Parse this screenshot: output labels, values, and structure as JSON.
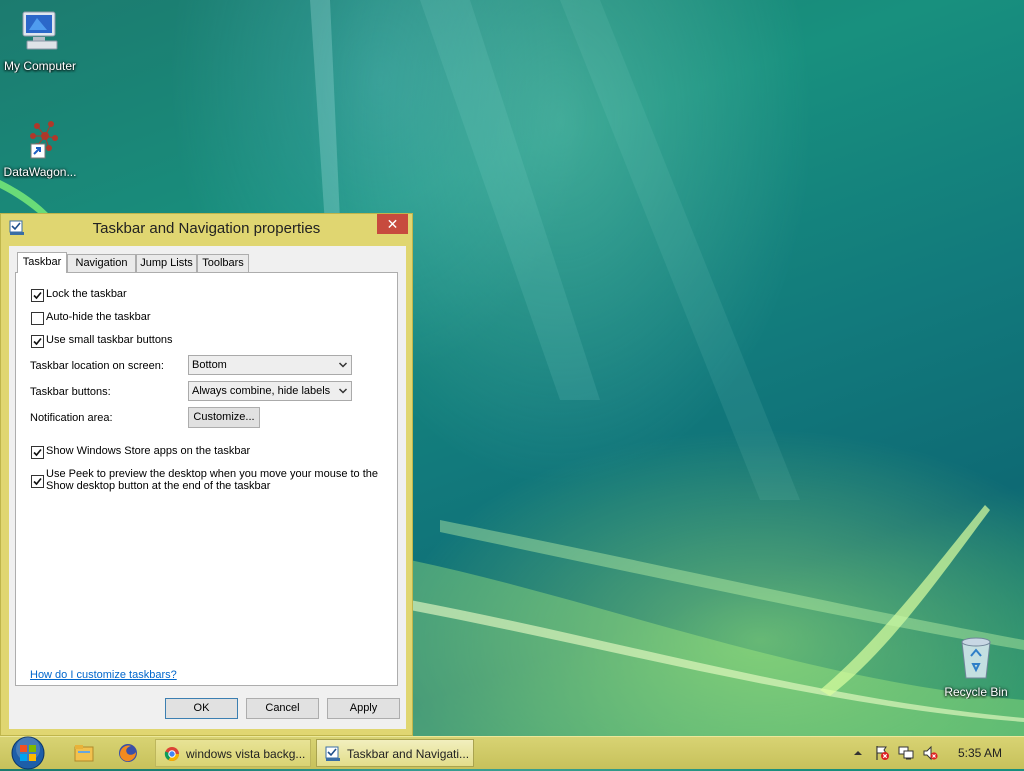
{
  "desktop": {
    "icons": [
      {
        "label": "My Computer"
      },
      {
        "label": "DataWagon..."
      },
      {
        "label": "Recycle Bin"
      }
    ]
  },
  "dialog": {
    "title": "Taskbar and Navigation properties",
    "close_glyph": "✕",
    "tabs": [
      {
        "label": "Taskbar"
      },
      {
        "label": "Navigation"
      },
      {
        "label": "Jump Lists"
      },
      {
        "label": "Toolbars"
      }
    ],
    "taskbar_tab": {
      "options": [
        {
          "label": "Lock the taskbar",
          "checked": true
        },
        {
          "label": "Auto-hide the taskbar",
          "checked": false
        },
        {
          "label": "Use small taskbar buttons",
          "checked": true
        }
      ],
      "location_label": "Taskbar location on screen:",
      "location_value": "Bottom",
      "buttons_label": "Taskbar buttons:",
      "buttons_value": "Always combine, hide labels",
      "notification_label": "Notification area:",
      "customize_label": "Customize...",
      "store_apps": {
        "label": "Show Windows Store apps on the taskbar",
        "checked": true
      },
      "peek": {
        "line1": "Use Peek to preview the desktop when you move your mouse to the",
        "line2": "Show desktop button at the end of the taskbar",
        "checked": true
      },
      "help_link": "How do I customize taskbars?"
    },
    "buttons": {
      "ok": "OK",
      "cancel": "Cancel",
      "apply": "Apply"
    }
  },
  "taskbar": {
    "windows": [
      {
        "label": "windows vista backg..."
      },
      {
        "label": "Taskbar and Navigati..."
      }
    ],
    "clock": "5:35 AM"
  },
  "colors": {
    "dialog_frame": "#e0d671",
    "close_button": "#c74b3e",
    "link": "#0066cc",
    "taskbar": "#d3cd6b"
  }
}
